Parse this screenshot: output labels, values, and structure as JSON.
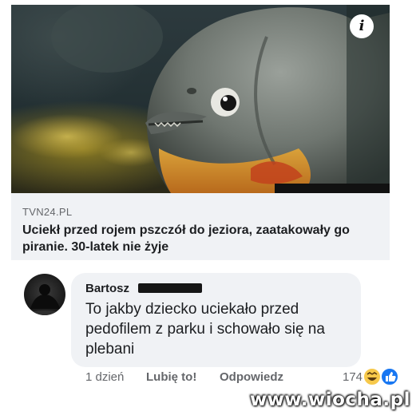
{
  "link_preview": {
    "source": "TVN24.PL",
    "headline": "Uciekł przed rojem pszczół do jeziora, zaatakowały go piranie. 30-latek nie żyje",
    "info_icon": "info-icon",
    "image": "piranha-photo"
  },
  "comment": {
    "author": "Bartosz",
    "text": "To jakby dziecko uciekało przed pedofilem z parku i schowało się na plebani",
    "time": "1 dzień",
    "like_label": "Lubię to!",
    "reply_label": "Odpowiedz",
    "reaction_count": "174",
    "reaction_icons": [
      "haha-emoji-icon",
      "like-thumb-icon"
    ]
  },
  "watermark": "www.wiocha.pl",
  "colors": {
    "card_bg": "#f0f2f5",
    "bubble_bg": "#f0f2f5",
    "text": "#1c1e21",
    "secondary_text": "#65676b",
    "like_blue": "#1877f2",
    "haha_yellow": "#f7c94b"
  }
}
